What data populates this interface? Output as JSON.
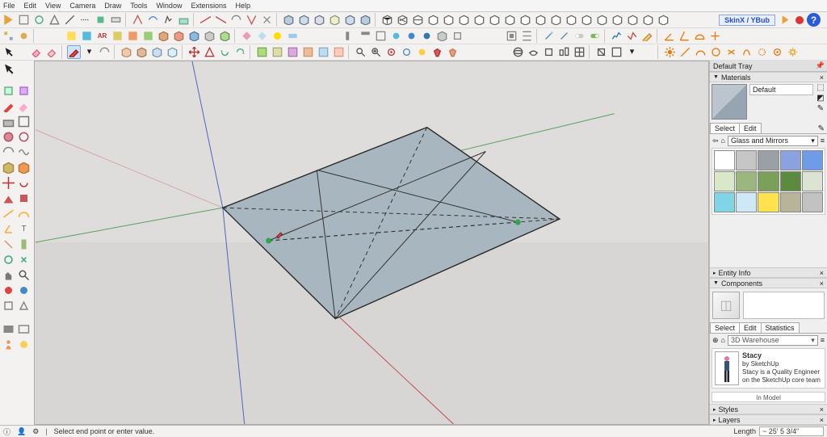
{
  "menu": [
    "File",
    "Edit",
    "View",
    "Camera",
    "Draw",
    "Tools",
    "Window",
    "Extensions",
    "Help"
  ],
  "skin": {
    "label": "SkinX / YBub"
  },
  "tray": {
    "title": "Default Tray",
    "materials": {
      "head": "Materials",
      "name": "Default",
      "tabs": [
        "Select",
        "Edit"
      ],
      "category": "Glass and Mirrors"
    },
    "materials_swatches": [
      "#ffffff",
      "#c6c6c6",
      "#9aa0a6",
      "#8aa2dd",
      "#6f9be8",
      "#d9e8c7",
      "#9bb77d",
      "#7aa05a",
      "#5c8a3f",
      "#dce3d2",
      "#7fd4e6",
      "#cfe8f7",
      "#ffe24d",
      "#b7b49a",
      "#c2c2c2"
    ],
    "entity_info": "Entity Info",
    "components": {
      "head": "Components",
      "tabs": [
        "Select",
        "Edit",
        "Statistics"
      ],
      "warehouse": "3D Warehouse"
    },
    "stacy": {
      "name": "Stacy",
      "by": "by SketchUp",
      "desc": "Stacy is a Quality Engineer on the SketchUp core team and a native ..."
    },
    "in_model": "In Model",
    "styles": "Styles",
    "layers": "Layers"
  },
  "status": {
    "hint": "Select end point or enter value.",
    "length_label": "Length",
    "length_value": "~ 25' 5 3/4\""
  }
}
